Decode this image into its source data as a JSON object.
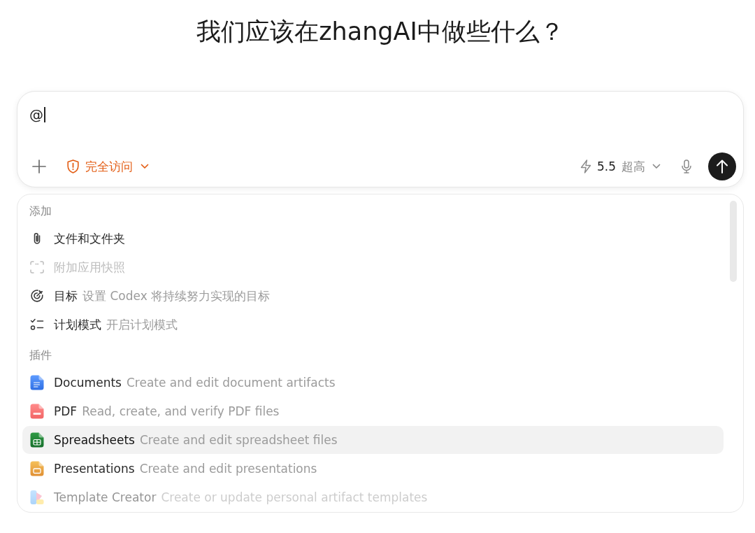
{
  "heading": "我们应该在zhangAI中做些什么？",
  "composer": {
    "value": "@",
    "access_menu": {
      "label": "完全访问"
    },
    "model_menu": {
      "version": "5.5",
      "effort": "超高"
    }
  },
  "mention_menu": {
    "sections": [
      {
        "title": "添加",
        "items": [
          {
            "label": "文件和文件夹",
            "disabled": false,
            "selected": false
          },
          {
            "label": "附加应用快照",
            "disabled": true,
            "selected": false
          },
          {
            "label": "目标",
            "description": "设置 Codex 将持续努力实现的目标",
            "disabled": false,
            "selected": false
          },
          {
            "label": "计划模式",
            "description": "开启计划模式",
            "disabled": false,
            "selected": false
          }
        ]
      },
      {
        "title": "插件",
        "items": [
          {
            "label": "Documents",
            "description": "Create and edit document artifacts",
            "disabled": false,
            "selected": false
          },
          {
            "label": "PDF",
            "description": "Read, create, and verify PDF files",
            "disabled": false,
            "selected": false
          },
          {
            "label": "Spreadsheets",
            "description": "Create and edit spreadsheet files",
            "disabled": false,
            "selected": true
          },
          {
            "label": "Presentations",
            "description": "Create and edit presentations",
            "disabled": false,
            "selected": false
          },
          {
            "label": "Template Creator",
            "description": "Create or update personal artifact templates",
            "disabled": false,
            "selected": false
          }
        ]
      }
    ]
  }
}
